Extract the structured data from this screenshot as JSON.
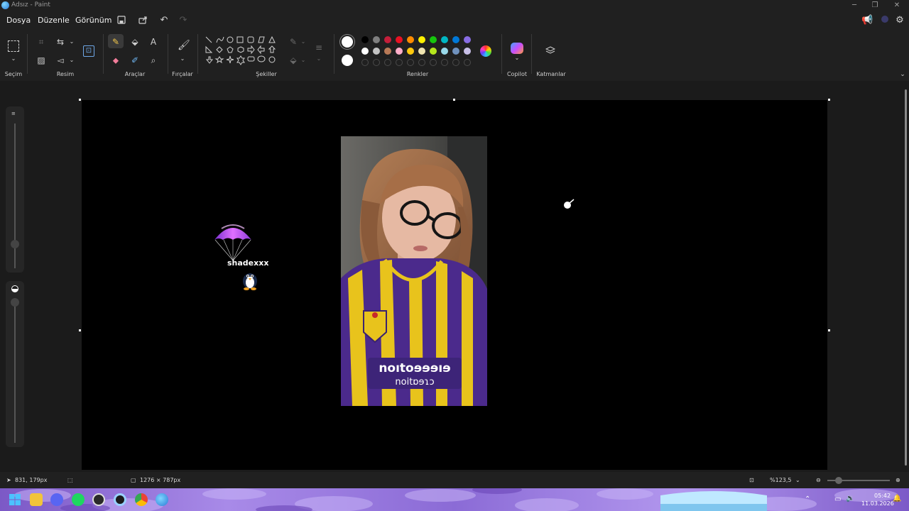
{
  "window": {
    "title": "Adsız - Paint"
  },
  "menu": {
    "file": "Dosya",
    "edit": "Düzenle",
    "view": "Görünüm"
  },
  "ribbon": {
    "groups": {
      "selection": "Seçim",
      "image": "Resim",
      "tools": "Araçlar",
      "brushes": "Fırçalar",
      "shapes": "Şekiller",
      "colors": "Renkler",
      "copilot": "Copilot",
      "layers": "Katmanlar"
    },
    "palette_row1": [
      "#000000",
      "#7f7f7f",
      "#c41e3a",
      "#e81123",
      "#ff8c00",
      "#fff100",
      "#16c60c",
      "#00b7c3",
      "#0078d7",
      "#886ce4"
    ],
    "palette_row2": [
      "#ffffff",
      "#c3c3c3",
      "#b97a57",
      "#ffaec9",
      "#ffc90e",
      "#efe4b0",
      "#b5e61d",
      "#99d9ea",
      "#7092be",
      "#c8bfe7"
    ]
  },
  "canvas": {
    "overlay_name": "shadexxx",
    "photo_shirt_text_line1": "noıtoɘɘɘıɘ",
    "photo_shirt_text_line2": "noitɒɘɿɔ"
  },
  "status": {
    "cursor_pos": "831, 179px",
    "canvas_size": "1276 × 787px",
    "zoom": "%123,5"
  },
  "taskbar": {
    "time": "05:42",
    "date": "11.03.2026"
  },
  "colors": {
    "app_bg": "#202020",
    "canvas_bg": "#000000",
    "jersey_purple": "#4b2a8c",
    "jersey_yellow": "#e8c31c"
  }
}
